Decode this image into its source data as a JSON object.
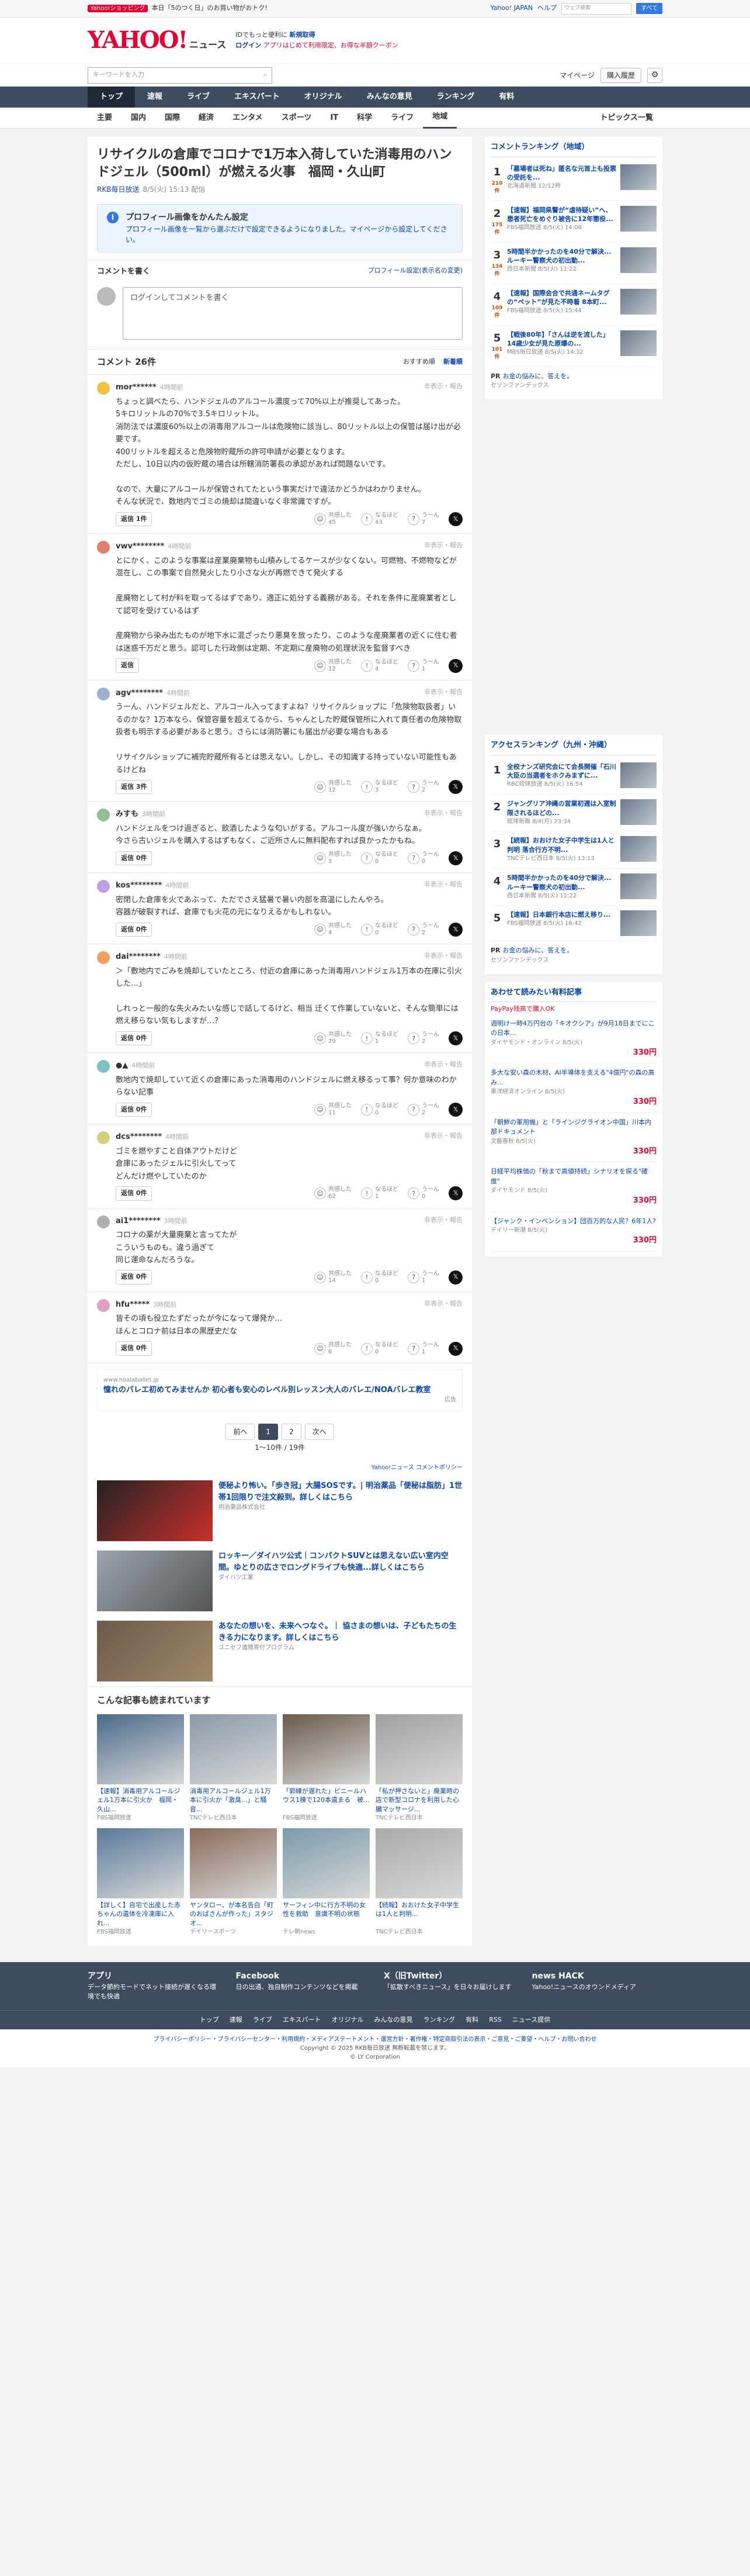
{
  "topbar": {
    "promo": "本日「5のつく日」のお買い物がおトク!",
    "pill": "Yahoo!ショッピング",
    "links": [
      "Yahoo! JAPAN",
      "ヘルプ"
    ],
    "search_placeholder": "ウェブ検索",
    "search_button": "すべて"
  },
  "header": {
    "logo": "YAHOO!",
    "news": "ニュース",
    "line1": "IDでもっと便利に",
    "new_reg": "新規取得",
    "login": "ログイン",
    "line2": "アプリはじめて利用限定、お得な半額クーポン"
  },
  "sub": {
    "placeholder": "キーワードを入力",
    "mypage": "マイページ",
    "paid": "購入履歴"
  },
  "nav1": [
    "トップ",
    "速報",
    "ライブ",
    "エキスパート",
    "オリジナル",
    "みんなの意見",
    "ランキング",
    "有料"
  ],
  "nav2": [
    "主要",
    "国内",
    "国際",
    "経済",
    "エンタメ",
    "スポーツ",
    "IT",
    "科学",
    "ライフ",
    "地域"
  ],
  "nav2_right": "トピックス一覧",
  "article": {
    "title": "リサイクルの倉庫でコロナで1万本入荷していた消毒用のハンドジェル（500ml）が燃える火事　福岡・久山町",
    "source": "RKB毎日放送",
    "date": "8/5(火) 15:13 配信"
  },
  "profile": {
    "title": "プロフィール画像をかんたん設定",
    "text": "プロフィール画像を一覧から選ぶだけで設定できるようになりました。マイページから設定してください。"
  },
  "comment_form": {
    "heading": "コメントを書く",
    "right": "プロフィール設定(表示名の変更)",
    "placeholder": "ログインしてコメントを書く"
  },
  "comments_header": {
    "count": "コメント 26件",
    "sort1": "おすすめ順",
    "sort2": "新着順"
  },
  "labels": {
    "empathy": "共感した",
    "insight": "なるほど",
    "maybe": "うーん",
    "reply": "返信",
    "report": "非表示・報告"
  },
  "comments": [
    {
      "user": "mor******",
      "time": "4時間前",
      "text": "ちょっと調べたら、ハンドジェルのアルコール濃度って70%以上が推奨してあった。\n5キロリットルの70%で3.5キロリットル。\n消防法では濃度60%以上の消毒用アルコールは危険物に該当し、80リットル以上の保管は届け出が必要です。\n400リットルを超えると危険物貯蔵所の許可申請が必要となります。\nただし、10日以内の仮貯蔵の場合は所轄消防署長の承認があれば問題ないです。\n\nなので、大量にアルコールが保管されてたという事実だけで違法かどうかはわかりません。\nそんな状況で、数地内でゴミの焼却は間違いなく非常識ですが。",
      "reply": "返信 1件",
      "e": "45",
      "i": "43",
      "m": "7"
    },
    {
      "user": "vwv********",
      "time": "4時間前",
      "text": "とにかく、このような事案は産業廃棄物も山積みしてるケースが少なくない。可燃物、不燃物などが混在し、この事案で自然発火したり小さな火が再燃できて発火する\n\n産廃物として村が料を取ってるはずであり、適正に処分する義務がある。それを条件に産廃業者として認可を受けているはず\n\n産廃物から染み出たものが地下水に混ざったり悪臭を放ったり、このような産廃業者の近くに住む者は迷惑千万だと思う。認可した行政側は定期、不定期に産廃物の処理状況を監督すべき",
      "reply": "返信",
      "e": "12",
      "i": "4",
      "m": "1"
    },
    {
      "user": "agv********",
      "time": "4時間前",
      "text": "うーん、ハンドジェルだと、アルコール入ってますよね？リサイクルショップに「危険物取扱者」いるのかな？1万本なら、保管容量を超えてるから、ちゃんとした貯蔵保管所に入れて責任者の危険物取扱者も明示する必要があると思う。さらには消防署にも届出が必要な場合もある\n\nリサイクルショップに補完貯蔵所有るとは思えない。しかし、その知識する持っていない可能性もあるけどね",
      "reply": "返信 3件",
      "e": "12",
      "i": "3",
      "m": "2"
    },
    {
      "user": "みすも",
      "time": "3時間前",
      "text": "ハンドジェルをつけ過ぎると、飲酒したような匂いがする。アルコール度が強いからなぁ。\n今さら古いジェルを購入するはずもなく、ご近所さんに無料配布すれば良かったかもね。",
      "reply": "返信 0件",
      "e": "3",
      "i": "0",
      "m": "0"
    },
    {
      "user": "kos********",
      "time": "4時間前",
      "text": "密閉した倉庫を火であぶって、ただでさえ猛暑で暑い内部を高温にしたんやろ。\n容器が破裂すれば、倉庫でも火花の元になりえるかもしれない。",
      "reply": "返信 0件",
      "e": "4",
      "i": "0",
      "m": "2"
    },
    {
      "user": "dai********",
      "time": "4時間前",
      "text": "＞「敷地内でごみを焼却していたところ、付近の倉庫にあった消毒用ハンドジェル1万本の在庫に引火した…」\n\nしれっと一般的な失火みたいな感じで話してるけど、相当 迂くて作業していないと、そんな簡単には燃え移らない気もしますが…？",
      "reply": "返信 0件",
      "e": "29",
      "i": "1",
      "m": "2"
    },
    {
      "user": "●▲",
      "time": "4時間前",
      "text": "敷地内で焼却していて近くの倉庫にあった消毒用のハンドジェルに燃え移るって事？何か意味のわからない記事",
      "reply": "返信 0件",
      "e": "11",
      "i": "0",
      "m": "2"
    },
    {
      "user": "dcs********",
      "time": "4時間前",
      "text": "ゴミを燃やすこと自体アウトだけど\n倉庫にあったジェルに引火してって\nどんだけ燃やしていたのか",
      "reply": "返信 0件",
      "e": "62",
      "i": "1",
      "m": "0"
    },
    {
      "user": "ai1********",
      "time": "3時間前",
      "text": "コロナの薬が大量廃棄と言ってたが\nこういうものも。違う過ぎて\n同じ運命なんだろうな。",
      "reply": "返信 0件",
      "e": "14",
      "i": "0",
      "m": "1"
    },
    {
      "user": "hfu*****",
      "time": "3時間前",
      "text": "皆その頃も役立たずだったが今になって爆発か…\nほんとコロナ前は日本の黒歴史だな",
      "reply": "返信 0件",
      "e": "6",
      "i": "0",
      "m": "1"
    }
  ],
  "ad": {
    "domain": "www.noalaballet.jp",
    "title": "憧れのバレエ初めてみませんか 初心者も安心のレベル別レッスン大人のバレエ/NOAバレエ教室",
    "note": "広告"
  },
  "pager": {
    "prev": "前へ",
    "p1": "1",
    "p2": "2",
    "next": "次へ",
    "info": "1〜10件 / 19件"
  },
  "yad": "Yahoo!ニュース コメントポリシー",
  "ads": [
    {
      "title": "便秘より怖い。「歩き冠」大腸SOSです。| 明治薬品「便秘は脂肪」1世帯1回限りで注文殺到。詳しくはこちら",
      "sponsor": "明治薬品株式会社"
    },
    {
      "title": "ロッキー／ダイハツ公式｜コンパクトSUVとは思えない広い室内空間。ゆとりの広さでロングドライブも快適...詳しくはこちら",
      "sponsor": "ダイハツ工業"
    },
    {
      "title": "あなたの想いを、未来へつなぐ。｜ 協さまの想いは、子どもたちの生きる力になります。詳しくはこちら",
      "sponsor": "ユニセフ遺贈寄付プログラム"
    }
  ],
  "rec_heading": "こんな記事も読まれています",
  "recs": [
    {
      "t": "【速報】消毒用アルコールジェル1万本に引火か　福岡・久山...",
      "s": "FBS福岡放送"
    },
    {
      "t": "消毒用アルコールジェル1万本に引火か「激臭...」と騒音...",
      "s": "TNCテレビ西日本"
    },
    {
      "t": "「郭練が遅れた」ビニールハウス1棟で120本遺まる　被...",
      "s": "FBS福岡放送"
    },
    {
      "t": "「私が押さないと」廃業時の店で新型コロナを利用した心臓マッサージ...",
      "s": "TNCテレビ西日本"
    },
    {
      "t": "【詳しく】自宅で出産した赤ちゃんの遺体を冷凍庫に入れ...",
      "s": "FBS福岡放送"
    },
    {
      "t": "ヤンタロー、が本名告白「町のおばさんが作った」スタジオ...",
      "s": "デイリースポーツ"
    },
    {
      "t": "サーフィン中に行方不明の女性を救助　意識不明の状態",
      "s": "テレ朝news"
    },
    {
      "t": "【続報】おおけた女子中学生は1人と判明...",
      "s": "TNCテレビ西日本"
    }
  ],
  "rank_local": {
    "title": "コメントランキング（地域）",
    "items": [
      {
        "n": "1",
        "c": "210件",
        "t": "「墓場者は死ね」匿名な元首上も投票の受託を...",
        "s": "北海道新聞 12/12時"
      },
      {
        "n": "2",
        "c": "175件",
        "t": "【速報】福岡県警が“虐待疑い”へ、患者死亡をめぐり被告に12年懲役...",
        "s": "FBS福岡放送 8/5(火) 14:08"
      },
      {
        "n": "3",
        "c": "134件",
        "t": "5時間半かかったのを40分で解決...ルーキー警察犬の初出動...",
        "s": "西日本新聞 8/5(火) 11:22"
      },
      {
        "n": "4",
        "c": "109件",
        "t": "【速報】国際会合で共通ネームタグの“ペット”が見た不時着 8本町...",
        "s": "FBS福岡放送 8/5(火) 15:44"
      },
      {
        "n": "5",
        "c": "101件",
        "t": "【戦後80年】「さんは逆を流した」14歳少女が見た原爆の...",
        "s": "MBS毎日放送 8/5(火) 14:32"
      }
    ]
  },
  "pr1": {
    "tag": "PR",
    "title": "お金の悩みに、答えを。",
    "sub": "セゾンファンデックス"
  },
  "rank_access": {
    "title": "アクセスランキング（九州・沖縄）",
    "items": [
      {
        "n": "1",
        "t": "全校ナンズ研究会にて会長開催「石川大臣の当選者をホクみまずに...",
        "s": "RBC琉球放送 8/5(火) 16:54"
      },
      {
        "n": "2",
        "t": "ジャングリア沖縄の営業初週は入室制限されるほどの...",
        "s": "琉球新報 8/4(月) 23:34"
      },
      {
        "n": "3",
        "t": "【続報】おおけた女子中学生は1人と判明 落合行方不明...",
        "s": "TNCテレビ西日本 8/5(火) 13:13"
      },
      {
        "n": "4",
        "t": "5時間半かかったのを40分で解決...ルーキー警察犬の初出動...",
        "s": "西日本新聞 8/5(火) 11:22"
      },
      {
        "n": "5",
        "t": "【速報】日本銀行本店に燃え移り...",
        "s": "FBS福岡放送 8/5(火) 16:42"
      }
    ]
  },
  "pr2": {
    "tag": "PR",
    "title": "お金の悩みに、答えを。",
    "sub": "セゾンファンデックス"
  },
  "rakuten": {
    "title": "あわせて読みたい有料記事",
    "label": "PayPay残高で購入OK",
    "items": [
      {
        "t": "週明け一時4万円台の「キオクシア」が9月18日までにこの日本...",
        "s": "ダイヤモンド・オンライン 8/5(火)",
        "p": "330円"
      },
      {
        "t": "多大な安い森の木材、AI半導体を支える\"4億円\"の森の高み...",
        "s": "東洋経済オンライン 8/5(火)",
        "p": "330円"
      },
      {
        "t": "「朝鮮の軍用機」と「ラインジグライオン中国」川本内部ドキュメント",
        "s": "文藝春秋 8/5(火)",
        "p": "330円"
      },
      {
        "t": "日経平均株価の「秋まで高値持続」シナリオを探る\"確度\"",
        "s": "ダイヤモンド 8/5(火)",
        "p": "330円"
      },
      {
        "t": "【ジャンク・インベンション】団百万的な人民？6年1人?",
        "s": "デイリー新潮 8/5(火)",
        "p": "330円"
      }
    ]
  },
  "app": [
    {
      "title": "アプリ",
      "text": "データ節約モードでネット接続が遅くなる環境でも快適"
    },
    {
      "title": "Facebook",
      "text": "日の出通、独自制作コンテンツなどを掲載"
    },
    {
      "title": "X（旧Twitter）",
      "text": "「拡散すべきニュース」を日々お届けします"
    },
    {
      "title": "news HACK",
      "text": "Yahoo!ニュースのオウンドメディア"
    }
  ],
  "footer": [
    "トップ",
    "速報",
    "ライブ",
    "エキスパート",
    "オリジナル",
    "みんなの意見",
    "ランキング",
    "有料",
    "RSS",
    "ニュース提供"
  ],
  "legal": "プライバシーポリシー・プライバシーセンター・利用規約・メディアステートメント・運営方針・著作権・特定商取引法の表示・ご意見・ご要望・ヘルプ・お問い合わせ",
  "copyright": "Copyright © 2025 RKB毎日放送 無断転載を禁じます。",
  "corp": "© LY Corporation"
}
